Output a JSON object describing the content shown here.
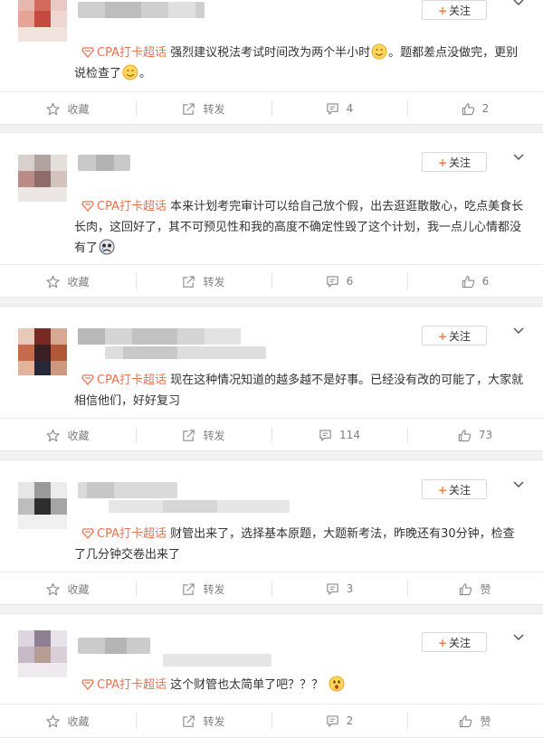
{
  "colors": {
    "accent": "#eb7350",
    "follow_plus": "#fa7d3c",
    "icon_gray": "#8a8a8a"
  },
  "posts": [
    {
      "follow_label": "关注",
      "tag": "CPA打卡超话",
      "text_parts": [
        "强烈建议税法考试时间改为两个半小时",
        "。题都差点没做完，更别说检查了",
        "。"
      ],
      "emojis": [
        "smile",
        "smile"
      ],
      "favorite_label": "收藏",
      "repost_label": "转发",
      "comment_count": "4",
      "like_count": "2"
    },
    {
      "follow_label": "关注",
      "tag": "CPA打卡超话",
      "text_parts": [
        "本来计划考完审计可以给自己放个假，出去逛逛散散心，吃点美食长长肉，这回好了，其不可预见性和我的高度不确定性毁了这个计划，我一点儿心情都没有了"
      ],
      "emojis": [
        "sad"
      ],
      "favorite_label": "收藏",
      "repost_label": "转发",
      "comment_count": "6",
      "like_count": "6"
    },
    {
      "follow_label": "关注",
      "tag": "CPA打卡超话",
      "text_parts": [
        "现在这种情况知道的越多越不是好事。已经没有改的可能了，大家就相信他们，好好复习"
      ],
      "favorite_label": "收藏",
      "repost_label": "转发",
      "comment_count": "114",
      "like_count": "73"
    },
    {
      "follow_label": "关注",
      "tag": "CPA打卡超话",
      "text_parts": [
        "财管出来了，选择基本原题，大题新考法，昨晚还有30分钟，检查了几分钟交卷出来了"
      ],
      "favorite_label": "收藏",
      "repost_label": "转发",
      "comment_count": "3",
      "like_label": "赞"
    },
    {
      "follow_label": "关注",
      "tag": "CPA打卡超话",
      "text_parts": [
        "这个财管也太简单了吧？？？"
      ],
      "emojis": [
        "surprised"
      ],
      "favorite_label": "收藏",
      "repost_label": "转发",
      "comment_count": "2",
      "like_label": "赞"
    }
  ]
}
